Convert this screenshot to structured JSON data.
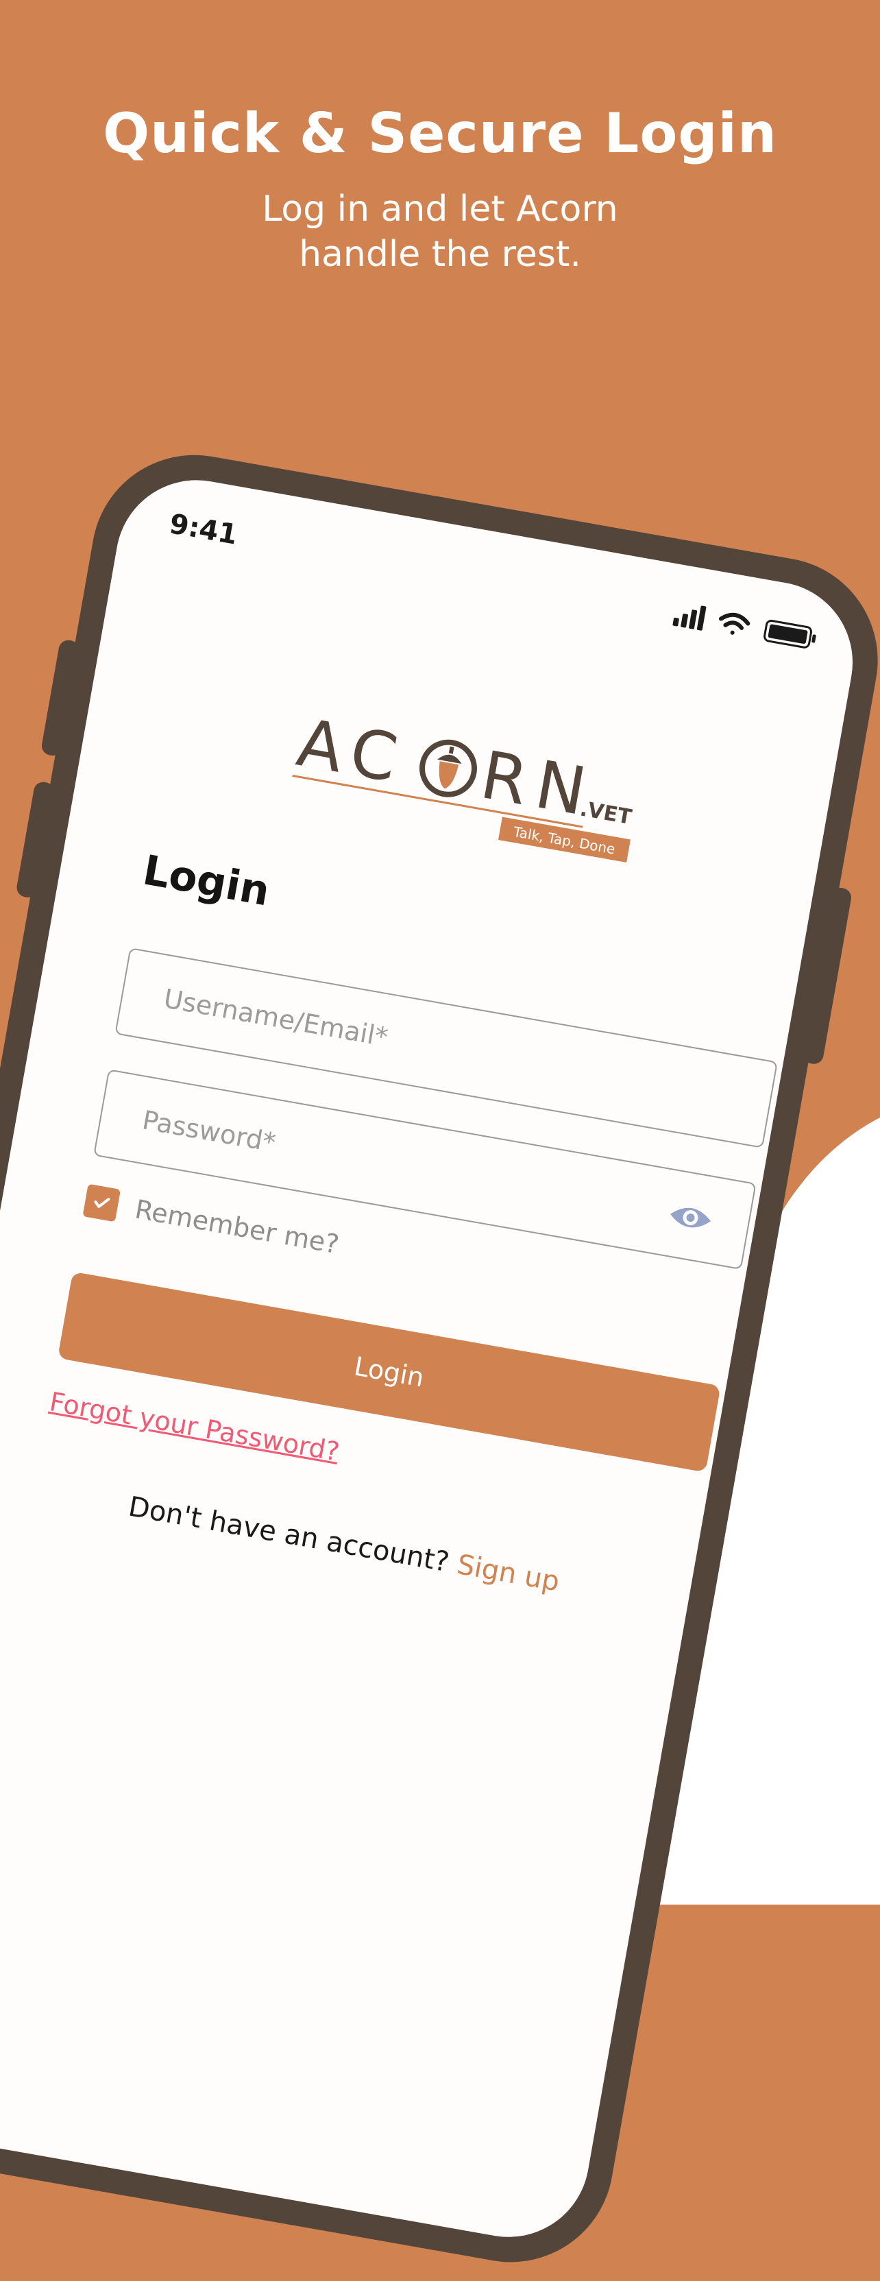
{
  "marketing": {
    "headline": "Quick & Secure Login",
    "subline_line1": "Log in and let Acorn",
    "subline_line2": "handle the rest."
  },
  "status_bar": {
    "time": "9:41",
    "icons": [
      "signal-icon",
      "wifi-icon",
      "battery-icon"
    ]
  },
  "brand": {
    "logo_text": "ACORN",
    "logo_suffix": ".VET",
    "tagline": "Talk, Tap, Done"
  },
  "form": {
    "title": "Login",
    "username_placeholder": "Username/Email*",
    "password_placeholder": "Password*",
    "remember_label": "Remember me?",
    "remember_checked": true,
    "login_label": "Login",
    "forgot_label": "Forgot your Password?",
    "signup_prompt": "Don't have an account?",
    "signup_label": "Sign up"
  },
  "colors": {
    "accent": "#d08251",
    "phone_frame": "#54453b",
    "link_pink": "#f05a74",
    "screen_bg": "#fffdfb"
  }
}
